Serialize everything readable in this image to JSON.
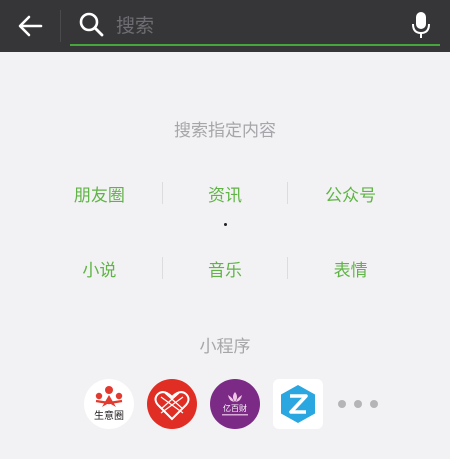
{
  "header": {
    "search_placeholder": "搜索",
    "back_icon": "arrow-left-icon",
    "search_icon": "search-icon",
    "mic_icon": "microphone-icon",
    "accent": "#46a63c"
  },
  "specific": {
    "title": "搜索指定内容",
    "row1": [
      "朋友圈",
      "资讯",
      "公众号"
    ],
    "row2": [
      "小说",
      "音乐",
      "表情"
    ],
    "link_color": "#5fb445"
  },
  "mini_programs": {
    "title": "小程序",
    "apps": [
      {
        "icon": "shengyiquan-app-icon",
        "label": "生意圈"
      },
      {
        "icon": "pinduoduo-app-icon"
      },
      {
        "icon": "purple-lotus-app-icon",
        "label": "亿百财"
      },
      {
        "icon": "zhihu-z-app-icon"
      }
    ],
    "more_icon": "more-dots-icon"
  }
}
